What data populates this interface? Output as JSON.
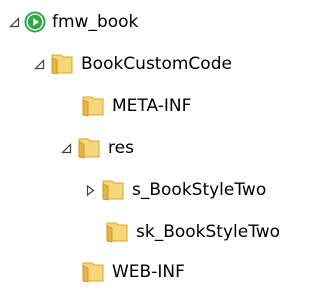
{
  "tree": {
    "project": {
      "label": "fmw_book",
      "toggle": "expanded",
      "icon": "project-run-icon"
    },
    "book_custom_code": {
      "label": "BookCustomCode",
      "toggle": "expanded",
      "icon": "folder-icon"
    },
    "meta_inf": {
      "label": "META-INF",
      "icon": "folder-icon"
    },
    "res": {
      "label": "res",
      "toggle": "expanded",
      "icon": "folder-icon"
    },
    "s_book_style_two": {
      "label": "s_BookStyleTwo",
      "toggle": "collapsed",
      "icon": "folder-icon"
    },
    "sk_book_style_two": {
      "label": "sk_BookStyleTwo",
      "icon": "folder-icon"
    },
    "web_inf": {
      "label": "WEB-INF",
      "icon": "folder-icon"
    }
  },
  "colors": {
    "folder_light": "#f6d67a",
    "folder_dark": "#d9a62c",
    "project_green": "#2fa64a",
    "toggle": "#404040"
  }
}
